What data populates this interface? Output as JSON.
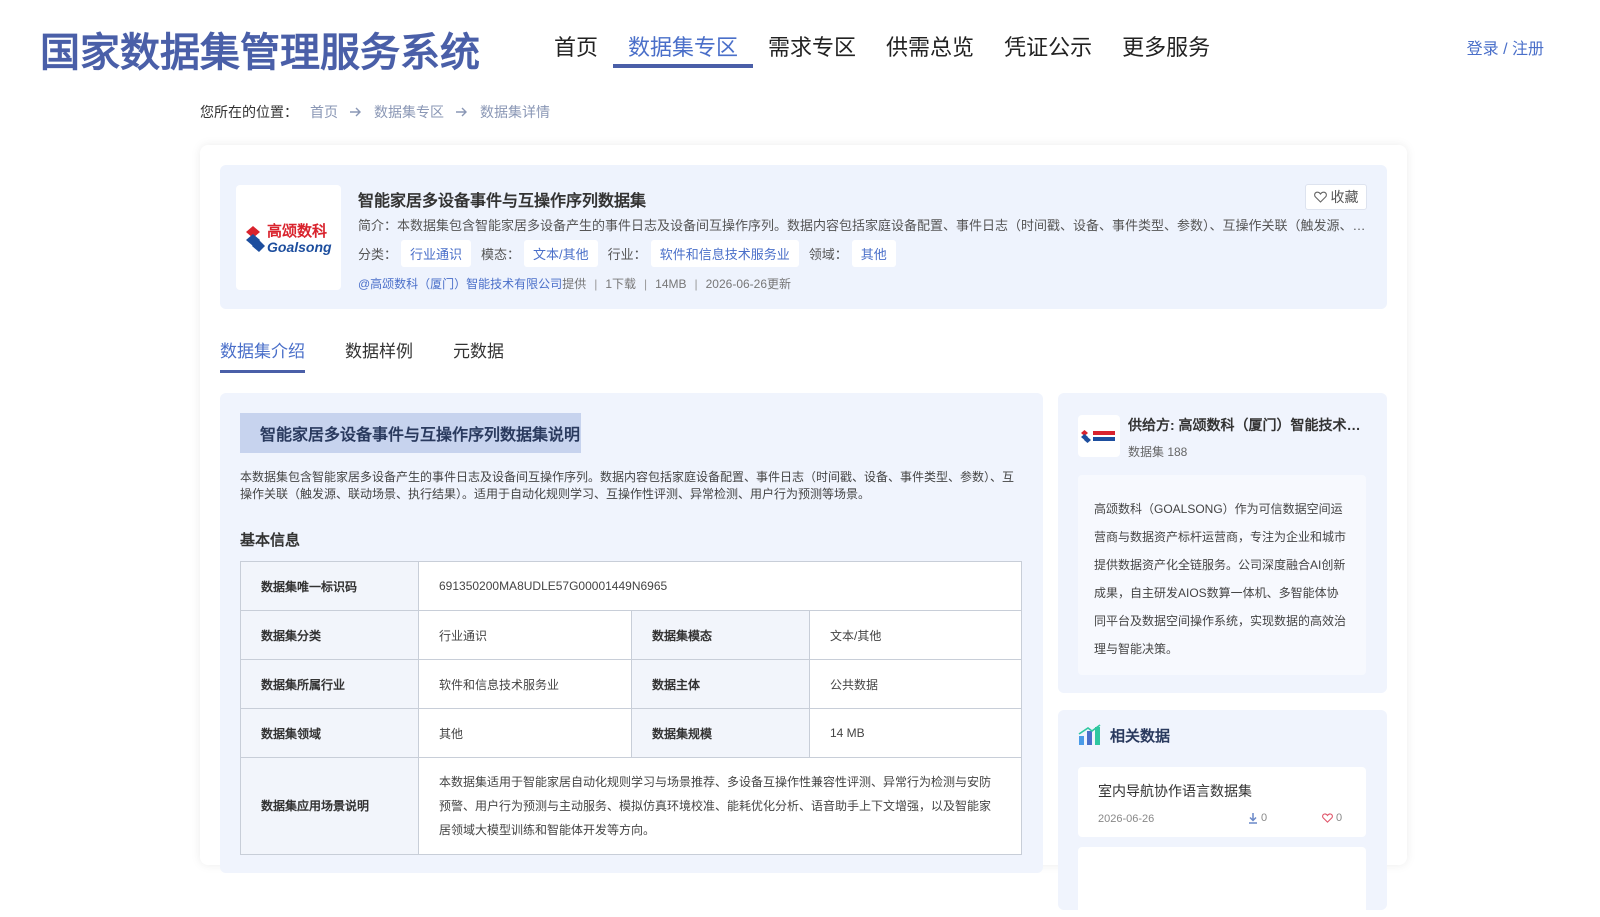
{
  "header": {
    "site_title": "国家数据集管理服务系统",
    "nav": [
      {
        "label": "首页",
        "active": false
      },
      {
        "label": "数据集专区",
        "active": true
      },
      {
        "label": "需求专区",
        "active": false
      },
      {
        "label": "供需总览",
        "active": false
      },
      {
        "label": "凭证公示",
        "active": false
      },
      {
        "label": "更多服务",
        "active": false
      }
    ],
    "login": "登录",
    "login_sep": " / ",
    "register": "注册"
  },
  "breadcrumb": {
    "prefix": "您所在的位置：",
    "items": [
      "首页",
      "数据集专区"
    ],
    "current": "数据集详情"
  },
  "dataset": {
    "logo_cn": "高颂数科",
    "logo_en": "Goalsong",
    "title": "智能家居多设备事件与互操作序列数据集",
    "favorite_label": "收藏",
    "desc": "简介：本数据集包含智能家居多设备产生的事件日志及设备间互操作序列。数据内容包括家庭设备配置、事件日志（时间戳、设备、事件类型、参数）、互操作关联（触发源、联动场景、执行结果）",
    "category_label": "分类：",
    "category": "行业通识",
    "modality_label": "模态：",
    "modality": "文本/其他",
    "industry_label": "行业：",
    "industry": "软件和信息技术服务业",
    "domain_label": "领域：",
    "domain": "其他",
    "provider": "@高颂数科（厦门）智能技术有限公司",
    "provider_suffix": "提供",
    "downloads": "1下载",
    "size": "14MB",
    "updated": "2026-06-26更新",
    "sep": "|"
  },
  "tabs": [
    {
      "label": "数据集介绍",
      "active": true
    },
    {
      "label": "数据样例",
      "active": false
    },
    {
      "label": "元数据",
      "active": false
    }
  ],
  "intro": {
    "section_title": "智能家居多设备事件与互操作序列数据集说明",
    "text": "本数据集包含智能家居多设备产生的事件日志及设备间互操作序列。数据内容包括家庭设备配置、事件日志（时间戳、设备、事件类型、参数）、互操作关联（触发源、联动场景、执行结果）。适用于自动化规则学习、互操作性评测、异常检测、用户行为预测等场景。",
    "basic_title": "基本信息"
  },
  "basic_info": {
    "uid_label": "数据集唯一标识码",
    "uid": "691350200MA8UDLE57G00001449N6965",
    "category_label": "数据集分类",
    "category": "行业通识",
    "modality_label": "数据集模态",
    "modality": "文本/其他",
    "industry_label": "数据集所属行业",
    "industry": "软件和信息技术服务业",
    "subject_label": "数据主体",
    "subject": "公共数据",
    "domain_label": "数据集领域",
    "domain": "其他",
    "scale_label": "数据集规模",
    "scale": "14 MB",
    "scenario_label": "数据集应用场景说明",
    "scenario": "本数据集适用于智能家居自动化规则学习与场景推荐、多设备互操作性兼容性评测、异常行为检测与安防预警、用户行为预测与主动服务、模拟仿真环境校准、能耗优化分析、语音助手上下文增强，以及智能家居领域大模型训练和智能体开发等方向。"
  },
  "provider_card": {
    "name": "供给方: 高颂数科（厦门）智能技术有限公司",
    "count": "数据集 188",
    "desc": "高颂数科（GOALSONG）作为可信数据空间运营商与数据资产标杆运营商，专注为企业和城市提供数据资产化全链服务。公司深度融合AI创新成果，自主研发AIOS数算一体机、多智能体协同平台及数据空间操作系统，实现数据的高效治理与智能决策。"
  },
  "related": {
    "title": "相关数据",
    "items": [
      {
        "title": "室内导航协作语言数据集",
        "date": "2026-06-26",
        "downloads": "0",
        "likes": "0"
      }
    ]
  },
  "colors": {
    "brand": "#4a5fa8",
    "accent": "#4a6fc9",
    "panel_bg": "#eef3fd",
    "like": "#e0556a"
  }
}
